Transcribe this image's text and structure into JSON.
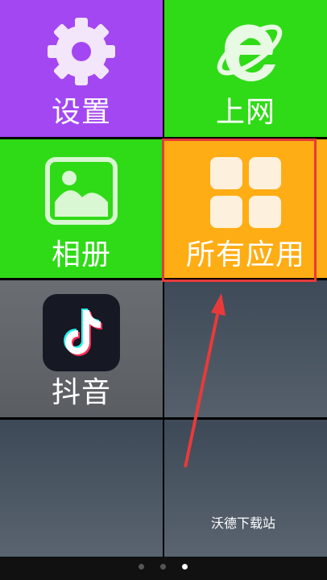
{
  "tiles": {
    "settings": "设置",
    "web": "上网",
    "album": "相册",
    "all_apps": "所有应用",
    "douyin": "抖音"
  },
  "watermark": "沃德下载站",
  "page_indicator": {
    "total": 3,
    "current": 3
  },
  "colors": {
    "settings": "#a347f2",
    "green": "#2fdb17",
    "apps": "#ffad14",
    "highlight": "#e83a3a"
  },
  "icons": [
    "gear-icon",
    "internet-explorer-icon",
    "photo-album-icon",
    "apps-grid-icon",
    "douyin-icon"
  ]
}
